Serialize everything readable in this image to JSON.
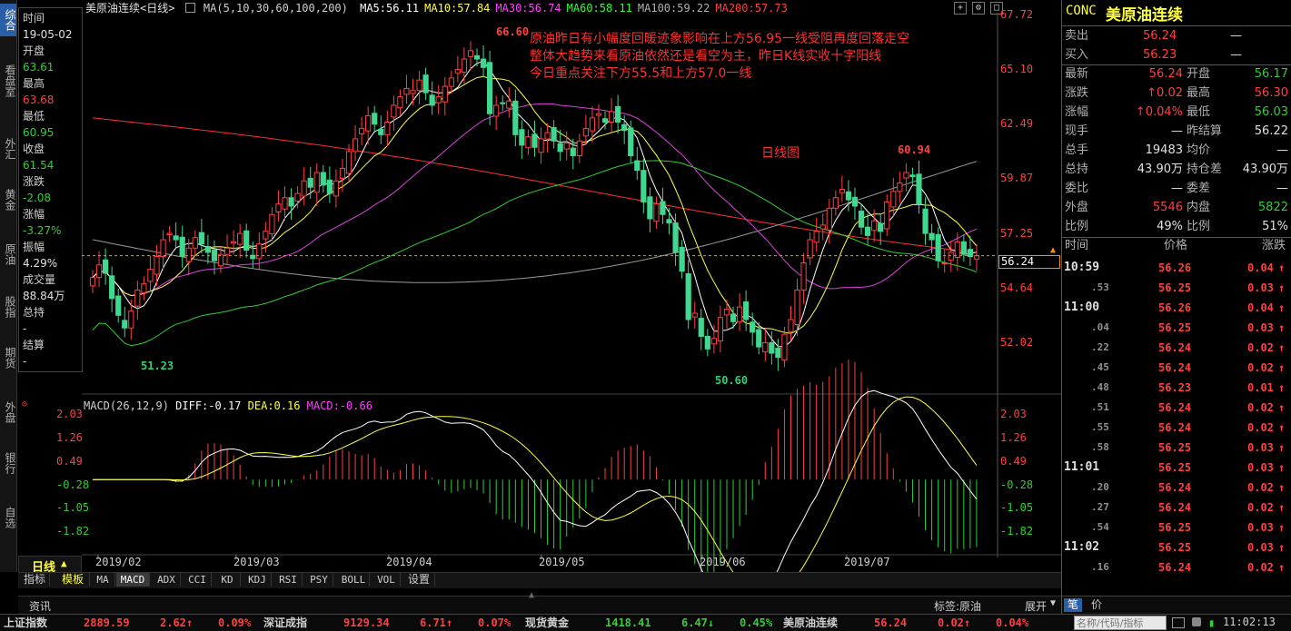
{
  "left_tabs": [
    "综合",
    "看盘室",
    "外汇",
    "黄金",
    "原油",
    "股指",
    "期货",
    "外盘",
    "银行",
    "自选"
  ],
  "info_panel": [
    {
      "label": "时间",
      "value": "19-05-02",
      "value_color": "#e0e0e0"
    },
    {
      "label": "开盘",
      "value": "63.61",
      "value_color": "#30d030"
    },
    {
      "label": "最高",
      "value": "63.68",
      "value_color": "#ff4040"
    },
    {
      "label": "最低",
      "value": "60.95",
      "value_color": "#30d030"
    },
    {
      "label": "收盘",
      "value": "61.54",
      "value_color": "#30d030"
    },
    {
      "label": "涨跌",
      "value": "-2.08",
      "value_color": "#30d030"
    },
    {
      "label": "涨幅",
      "value": "-3.27%",
      "value_color": "#30d030"
    },
    {
      "label": "振幅",
      "value": "4.29%",
      "value_color": "#e0e0e0"
    },
    {
      "label": "成交量",
      "value": "88.84万",
      "value_color": "#e0e0e0"
    },
    {
      "label": "总持",
      "value": "-",
      "value_color": "#e0e0e0"
    },
    {
      "label": "结算",
      "value": "-",
      "value_color": "#e0e0e0"
    }
  ],
  "header": {
    "title": "美原油连续<日线>",
    "ma_label": "MA(5,10,30,60,100,200)",
    "ma_values": [
      {
        "text": "MA5:56.11",
        "color": "#ffffff"
      },
      {
        "text": "MA10:57.84",
        "color": "#ffff40"
      },
      {
        "text": "MA30:56.74",
        "color": "#ff40ff"
      },
      {
        "text": "MA60:58.11",
        "color": "#30ff30"
      },
      {
        "text": "MA100:59.22",
        "color": "#b0b0b0"
      },
      {
        "text": "MA200:57.73",
        "color": "#ff4040"
      }
    ]
  },
  "annotations": {
    "line1": "原油昨日有小幅度回暖迹象影响在上方56.95一线受阻再度回落走空",
    "line2": "整体大趋势来看原油依然还是看空为主，昨日K线实收十字阳线",
    "line3": "今日重点关注下方55.5和上方57.0一线",
    "label": "日线图"
  },
  "price_marks": {
    "high": "66.60",
    "low1": "51.23",
    "low2": "50.60",
    "high2": "60.94",
    "current": "56.24"
  },
  "price_axis": [
    "67.72",
    "65.10",
    "62.49",
    "59.87",
    "57.25",
    "54.64",
    "52.02"
  ],
  "macd_header": {
    "title": "MACD(26,12,9)",
    "diff": "DIFF:-0.17",
    "dea": "DEA:0.16",
    "macd": "MACD:-0.66"
  },
  "macd_axis": [
    "2.03",
    "1.26",
    "0.49",
    "-0.28",
    "-1.05",
    "-1.82"
  ],
  "date_axis": [
    "2019/02",
    "2019/03",
    "2019/04",
    "2019/05",
    "2019/06",
    "2019/07"
  ],
  "period_label": "日线",
  "indicator_tabs": [
    "指标",
    "模板",
    "MA",
    "MACD",
    "ADX",
    "CCI",
    "KD",
    "KDJ",
    "RSI",
    "PSY",
    "BOLL",
    "VOL",
    "设置"
  ],
  "bottom_bar": {
    "news": "资讯",
    "tag_label": "标签:原油",
    "expand": "展开"
  },
  "quote": {
    "code": "CONC",
    "name": "美原油连续",
    "sell": "56.24",
    "buy": "56.23",
    "sell_vol": "—",
    "buy_vol": "—",
    "rows": [
      {
        "l1": "最新",
        "v1": "56.24",
        "c1": "#ff4040",
        "l2": "开盘",
        "v2": "56.17",
        "c2": "#30d030"
      },
      {
        "l1": "涨跌",
        "v1": "↑0.02",
        "c1": "#ff4040",
        "l2": "最高",
        "v2": "56.30",
        "c2": "#ff4040"
      },
      {
        "l1": "涨幅",
        "v1": "↑0.04%",
        "c1": "#ff4040",
        "l2": "最低",
        "v2": "56.03",
        "c2": "#30d030"
      },
      {
        "l1": "现手",
        "v1": "—",
        "c1": "#e0e0e0",
        "l2": "昨结算",
        "v2": "56.22",
        "c2": "#e0e0e0"
      },
      {
        "l1": "总手",
        "v1": "19483",
        "c1": "#e0e0e0",
        "l2": "均价",
        "v2": "—",
        "c2": "#e0e0e0"
      },
      {
        "l1": "总持",
        "v1": "43.90万",
        "c1": "#e0e0e0",
        "l2": "持仓差",
        "v2": "43.90万",
        "c2": "#e0e0e0"
      },
      {
        "l1": "委比",
        "v1": "—",
        "c1": "#e0e0e0",
        "l2": "委差",
        "v2": "—",
        "c2": "#e0e0e0"
      },
      {
        "l1": "外盘",
        "v1": "5546",
        "c1": "#ff4040",
        "l2": "内盘",
        "v2": "5822",
        "c2": "#30d030"
      },
      {
        "l1": "比例",
        "v1": "49%",
        "c1": "#e0e0e0",
        "l2": "比例",
        "v2": "51%",
        "c2": "#e0e0e0"
      }
    ]
  },
  "trades_header": {
    "time": "时间",
    "price": "价格",
    "change": "涨跌"
  },
  "trades": [
    {
      "time": "10:59",
      "price": "56.26",
      "change": "0.04",
      "major": true
    },
    {
      "time": ".53",
      "price": "56.25",
      "change": "0.03",
      "major": false
    },
    {
      "time": "11:00",
      "price": "56.26",
      "change": "0.04",
      "major": true
    },
    {
      "time": ".04",
      "price": "56.25",
      "change": "0.03",
      "major": false
    },
    {
      "time": ".22",
      "price": "56.24",
      "change": "0.02",
      "major": false
    },
    {
      "time": ".45",
      "price": "56.24",
      "change": "0.02",
      "major": false
    },
    {
      "time": ".48",
      "price": "56.23",
      "change": "0.01",
      "major": false
    },
    {
      "time": ".51",
      "price": "56.24",
      "change": "0.02",
      "major": false
    },
    {
      "time": ".55",
      "price": "56.24",
      "change": "0.02",
      "major": false
    },
    {
      "time": ".58",
      "price": "56.25",
      "change": "0.03",
      "major": false
    },
    {
      "time": "11:01",
      "price": "56.25",
      "change": "0.03",
      "major": true
    },
    {
      "time": ".20",
      "price": "56.24",
      "change": "0.02",
      "major": false
    },
    {
      "time": ".27",
      "price": "56.24",
      "change": "0.02",
      "major": false
    },
    {
      "time": ".54",
      "price": "56.25",
      "change": "0.03",
      "major": false
    },
    {
      "time": "11:02",
      "price": "56.25",
      "change": "0.03",
      "major": true
    },
    {
      "time": ".16",
      "price": "56.24",
      "change": "0.02",
      "major": false
    }
  ],
  "right_bottom_tabs": [
    "笔",
    "价"
  ],
  "status_bar": [
    {
      "name": "上证指数",
      "value": "2889.59",
      "change": "2.62↑",
      "pct": "0.09%",
      "color": "#ff4040"
    },
    {
      "name": "深证成指",
      "value": "9129.34",
      "change": "6.71↑",
      "pct": "0.07%",
      "color": "#ff4040"
    },
    {
      "name": "现货黄金",
      "value": "1418.41",
      "change": "6.47↓",
      "pct": "0.45%",
      "color": "#30d030"
    },
    {
      "name": "美原油连续",
      "value": "56.24",
      "change": "0.02↑",
      "pct": "0.04%",
      "color": "#ff4040"
    }
  ],
  "search_placeholder": "名称/代码/指标",
  "clock": "11:02:13",
  "colors": {
    "up": "#ff4040",
    "down": "#30d070",
    "bg": "#000000",
    "accent": "#2a5fa8"
  },
  "chart_data": {
    "type": "candlestick",
    "price_ylim": [
      50.0,
      67.72
    ],
    "macd_ylim": [
      -2.3,
      2.2
    ],
    "x_dates": [
      "2019/02",
      "2019/03",
      "2019/04",
      "2019/05",
      "2019/06",
      "2019/07"
    ],
    "closes": [
      55.2,
      55.8,
      55.4,
      54.2,
      53.4,
      52.8,
      53.6,
      54.6,
      54.9,
      55.6,
      56.2,
      57.0,
      57.3,
      57.0,
      56.2,
      56.6,
      57.1,
      56.8,
      56.4,
      56.0,
      56.3,
      56.6,
      56.9,
      57.3,
      56.5,
      56.1,
      56.8,
      57.4,
      58.2,
      58.7,
      59.0,
      58.6,
      59.2,
      59.8,
      59.5,
      60.2,
      59.6,
      59.2,
      59.8,
      60.4,
      61.2,
      61.8,
      62.3,
      62.9,
      62.5,
      62.0,
      62.6,
      63.4,
      63.8,
      64.2,
      64.1,
      64.6,
      64.0,
      63.4,
      63.8,
      64.3,
      64.7,
      65.1,
      65.6,
      66.0,
      65.6,
      65.2,
      63.0,
      63.4,
      63.5,
      63.6,
      62.0,
      61.5,
      61.9,
      61.4,
      61.8,
      62.1,
      61.7,
      61.2,
      61.6,
      61.0,
      61.7,
      62.3,
      62.8,
      63.0,
      62.6,
      63.1,
      62.6,
      62.2,
      61.0,
      60.3,
      58.8,
      58.0,
      58.7,
      58.2,
      57.8,
      56.4,
      55.5,
      53.2,
      53.5,
      52.4,
      51.8,
      52.3,
      53.3,
      53.7,
      53.1,
      53.8,
      53.2,
      52.6,
      51.9,
      52.1,
      51.6,
      51.4,
      52.5,
      53.2,
      54.6,
      55.9,
      57.0,
      57.4,
      57.7,
      58.5,
      59.0,
      59.4,
      58.9,
      58.6,
      57.6,
      57.2,
      57.9,
      57.4,
      58.8,
      59.3,
      59.7,
      60.2,
      60.0,
      58.7,
      57.3,
      57.0,
      56.0,
      55.9,
      56.4,
      56.9,
      56.3,
      56.2,
      56.24
    ],
    "macd_diff_end": -0.17,
    "macd_dea_end": 0.16,
    "macd_hist_end": -0.66
  }
}
